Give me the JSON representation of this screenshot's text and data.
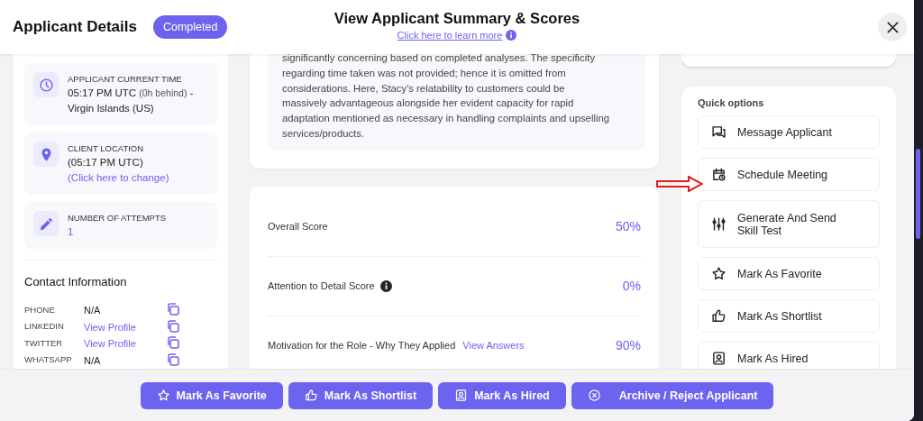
{
  "header": {
    "title": "Applicant Details",
    "status": "Completed",
    "center_title": "View Applicant Summary & Scores",
    "learn_link": "Click here to learn more"
  },
  "applicant_info": [
    {
      "kind": "time",
      "label": "APPLICANT CURRENT TIME",
      "value": "05:17 PM UTC",
      "muted": "(0h behind)",
      "rest": "- Virgin Islands (US)"
    },
    {
      "kind": "location",
      "label": "CLIENT LOCATION",
      "value": "(05:17 PM UTC)",
      "link": "(Click here to change)"
    },
    {
      "kind": "attempts",
      "label": "NUMBER OF ATTEMPTS",
      "link": "1"
    }
  ],
  "contact": {
    "title": "Contact Information",
    "rows": [
      {
        "label": "PHONE",
        "value": "N/A",
        "kind": "text"
      },
      {
        "label": "LINKEDIN",
        "value": "View Profile",
        "kind": "link"
      },
      {
        "label": "TWITTER",
        "value": "View Profile",
        "kind": "link"
      },
      {
        "label": "WHATSAPP",
        "value": "N/A",
        "kind": "text"
      }
    ]
  },
  "summary": "significantly concerning based on completed analyses. The specificity regarding time taken was not provided; hence it is omitted from considerations. Here, Stacy's relatability to customers could be massively advantageous alongside her evident capacity for rapid adaptation mentioned as necessary in handling complaints and upselling services/products.",
  "scores": [
    {
      "label": "Overall Score",
      "info": false,
      "value": "50%"
    },
    {
      "label": "Attention to Detail Score",
      "info": true,
      "value": "0%"
    },
    {
      "label": "Motivation for the Role - Why They Applied",
      "link": "View Answers",
      "info": false,
      "value": "90%"
    }
  ],
  "quick_options": {
    "title": "Quick options",
    "items": [
      {
        "kind": "message",
        "label": "Message Applicant"
      },
      {
        "kind": "calendar",
        "label": "Schedule Meeting"
      },
      {
        "kind": "sliders",
        "label": "Generate And Send Skill Test"
      },
      {
        "kind": "star",
        "label": "Mark As Favorite"
      },
      {
        "kind": "thumb",
        "label": "Mark As Shortlist"
      },
      {
        "kind": "person",
        "label": "Mark As Hired"
      }
    ]
  },
  "footer_buttons": [
    {
      "kind": "star",
      "label": "Mark As Favorite"
    },
    {
      "kind": "thumb",
      "label": "Mark As Shortlist"
    },
    {
      "kind": "person",
      "label": "Mark As Hired"
    },
    {
      "kind": "close",
      "label": "Archive / Reject Applicant"
    }
  ]
}
